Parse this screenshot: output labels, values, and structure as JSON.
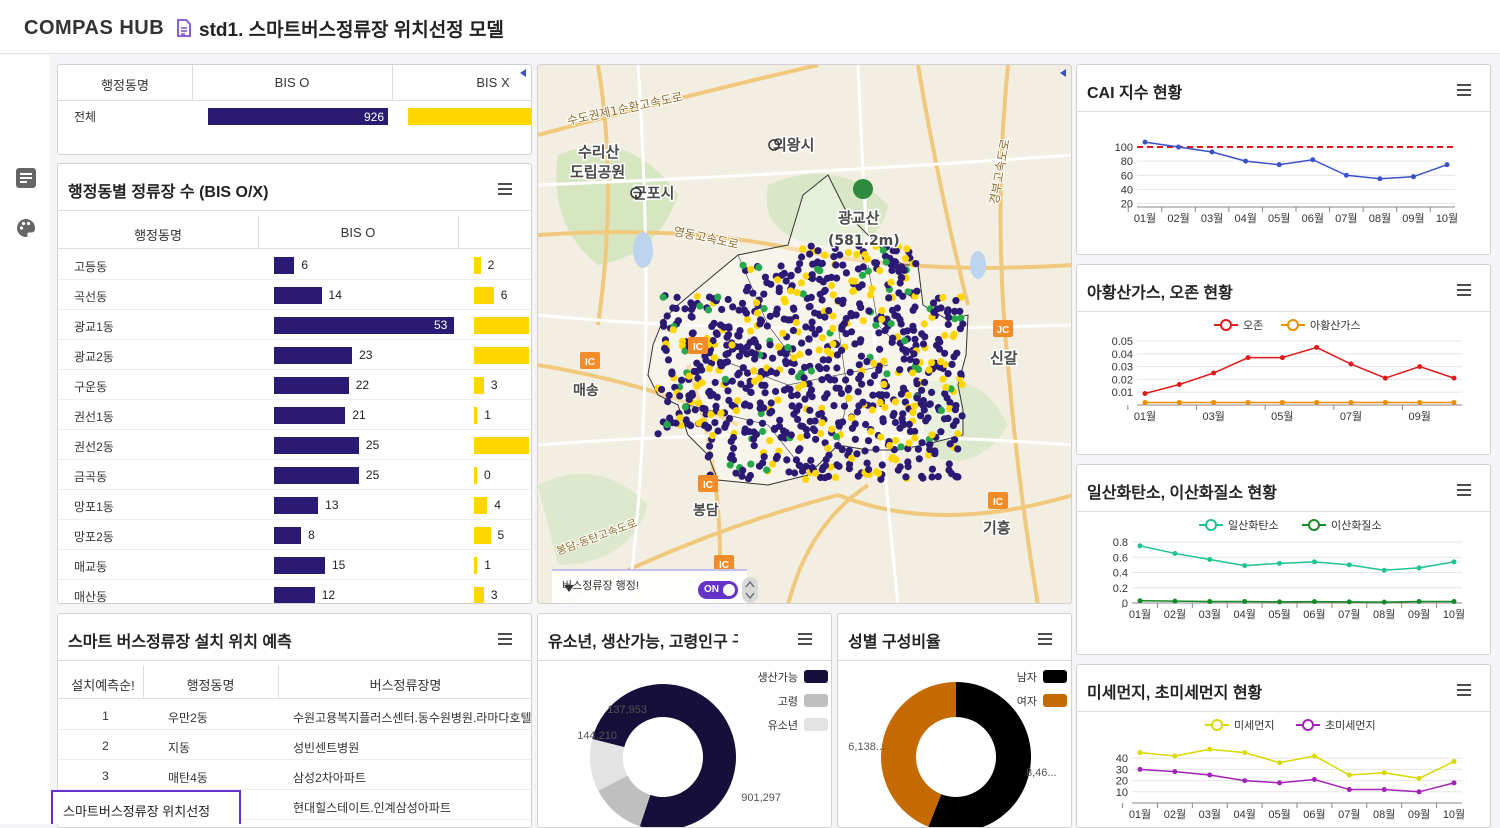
{
  "header": {
    "logo": "COMPAS HUB",
    "title": "std1. 스마트버스정류장 위치선정 모델"
  },
  "summary_table": {
    "headers": [
      "행정동명",
      "BIS O",
      "BIS X"
    ],
    "row": {
      "name": "전체",
      "bis_o": 926
    }
  },
  "dong_panel": {
    "title": "행정동별 정류장 수 (BIS O/X)",
    "headers": [
      "행정동명",
      "BIS O"
    ],
    "max_o": 53,
    "rows": [
      {
        "name": "고등동",
        "o": 6,
        "x": 2,
        "x_label": "2"
      },
      {
        "name": "곡선동",
        "o": 14,
        "x": 6,
        "x_label": "6"
      },
      {
        "name": "광교1동",
        "o": 53,
        "x": 20,
        "x_label": ""
      },
      {
        "name": "광교2동",
        "o": 23,
        "x": 20,
        "x_label": ""
      },
      {
        "name": "구운동",
        "o": 22,
        "x": 3,
        "x_label": "3"
      },
      {
        "name": "권선1동",
        "o": 21,
        "x": 1,
        "x_label": "1"
      },
      {
        "name": "권선2동",
        "o": 25,
        "x": 20,
        "x_label": ""
      },
      {
        "name": "금곡동",
        "o": 25,
        "x": 0,
        "x_label": "0"
      },
      {
        "name": "망포1동",
        "o": 13,
        "x": 4,
        "x_label": "4"
      },
      {
        "name": "망포2동",
        "o": 8,
        "x": 5,
        "x_label": "5"
      },
      {
        "name": "매교동",
        "o": 15,
        "x": 1,
        "x_label": "1"
      },
      {
        "name": "매산동",
        "o": 12,
        "x": 3,
        "x_label": "3"
      }
    ]
  },
  "smart_panel": {
    "title": "스마트 버스정류장 설치 위치 예측",
    "headers": [
      "설치예측순!",
      "행정동명",
      "버스정류장명"
    ],
    "rows": [
      {
        "rank": "1",
        "dong": "우만2동",
        "stop": "수원고용복지플러스센터.동수원병원.라마다호텔"
      },
      {
        "rank": "2",
        "dong": "지동",
        "stop": "성빈센트병원"
      },
      {
        "rank": "3",
        "dong": "매탄4동",
        "stop": "삼성2차아파트"
      },
      {
        "rank": "",
        "dong": "",
        "stop": "현대힐스테이트.인계삼성아파트"
      }
    ]
  },
  "footer_tab": {
    "label": "스마트버스정류장 위치선정"
  },
  "map": {
    "labels": [
      "의왕시",
      "수리산",
      "도립공원",
      "군포시",
      "광교산",
      "(581.2m)",
      "매송",
      "신갈",
      "봉담",
      "기흥"
    ],
    "ic_labels": [
      "IC",
      "JC",
      "IC",
      "IC",
      "IC",
      "IC"
    ],
    "road_labels": [
      "수도권제1순환고속도로",
      "영동고속도로",
      "경부고속도로",
      "봉담-동탄고속도로"
    ],
    "legend_text": "버스정류장 행정!",
    "toggle": "ON"
  },
  "cai_panel": {
    "title": "CAI 지수 현황",
    "chart_data": {
      "type": "line",
      "categories": [
        "01월",
        "02월",
        "03월",
        "04월",
        "05월",
        "06월",
        "07월",
        "08월",
        "09월",
        "10월"
      ],
      "series": [
        {
          "values": [
            107,
            100,
            93,
            80,
            75,
            82,
            60,
            55,
            58,
            75
          ],
          "color": "#3a52c8"
        }
      ],
      "reference_line": 100,
      "yticks": [
        20,
        40,
        60,
        80,
        100
      ],
      "ylim": [
        15,
        110
      ]
    }
  },
  "ozone_panel": {
    "title": "아황산가스, 오존 현황",
    "chart_data": {
      "type": "line",
      "categories": [
        "01월",
        "02월",
        "03월",
        "04월",
        "05월",
        "06월",
        "07월",
        "08월",
        "09월",
        "10월"
      ],
      "xticks": [
        "01월",
        "03월",
        "05월",
        "07월",
        "09월"
      ],
      "series": [
        {
          "name": "오존",
          "values": [
            0.009,
            0.016,
            0.025,
            0.037,
            0.037,
            0.045,
            0.032,
            0.021,
            0.03,
            0.021
          ],
          "color": "#e01a1a"
        },
        {
          "name": "아황산가스",
          "values": [
            0.002,
            0.002,
            0.002,
            0.002,
            0.002,
            0.002,
            0.002,
            0.002,
            0.002,
            0.002
          ],
          "color": "#f08c00"
        }
      ],
      "yticks": [
        0.01,
        0.02,
        0.03,
        0.04,
        0.05
      ],
      "ylim": [
        0,
        0.05
      ]
    }
  },
  "co_panel": {
    "title": "일산화탄소, 이산화질소 현황",
    "chart_data": {
      "type": "line",
      "categories": [
        "01월",
        "02월",
        "03월",
        "04월",
        "05월",
        "06월",
        "07월",
        "08월",
        "09월",
        "10월"
      ],
      "series": [
        {
          "name": "일산화탄소",
          "values": [
            0.75,
            0.65,
            0.57,
            0.49,
            0.52,
            0.54,
            0.5,
            0.43,
            0.46,
            0.54
          ],
          "color": "#1ec493"
        },
        {
          "name": "이산화질소",
          "values": [
            0.03,
            0.025,
            0.02,
            0.02,
            0.015,
            0.018,
            0.015,
            0.012,
            0.02,
            0.02
          ],
          "color": "#128a25"
        }
      ],
      "yticks": [
        0,
        0.2,
        0.4,
        0.6,
        0.8
      ],
      "ylim": [
        0,
        0.8
      ]
    }
  },
  "dust_panel": {
    "title": "미세먼지, 초미세먼지 현황",
    "chart_data": {
      "type": "line",
      "categories": [
        "01월",
        "02월",
        "03월",
        "04월",
        "05월",
        "06월",
        "07월",
        "08월",
        "09월",
        "10월"
      ],
      "series": [
        {
          "name": "미세먼지",
          "values": [
            45,
            42,
            48,
            45,
            36,
            42,
            25,
            27,
            22,
            37
          ],
          "color": "#d9d900"
        },
        {
          "name": "초미세먼지",
          "values": [
            30,
            28,
            25,
            20,
            18,
            21,
            12,
            12,
            10,
            18
          ],
          "color": "#a322b8"
        }
      ],
      "yticks": [
        10,
        20,
        30,
        40
      ],
      "ylim": [
        0,
        50
      ]
    }
  },
  "age_panel": {
    "title": "유소년, 생산가능, 고령인구 구",
    "chart_data": {
      "type": "pie",
      "donut": true,
      "labels": [
        "생산가능",
        "고령",
        "유소년"
      ],
      "values": [
        901297,
        144210,
        137953
      ],
      "value_labels": [
        "901,297",
        "144,210",
        "137,953"
      ],
      "colors": [
        "#150f3a",
        "#bfbfbf",
        "#e3e3e3"
      ]
    }
  },
  "gender_panel": {
    "title": "성별 구성비율",
    "chart_data": {
      "type": "pie",
      "donut": true,
      "labels": [
        "남자",
        "여자"
      ],
      "values": [
        56,
        44
      ],
      "value_labels": [
        "8,46...",
        "6,138..."
      ],
      "colors": [
        "#000000",
        "#c46a00"
      ]
    }
  }
}
